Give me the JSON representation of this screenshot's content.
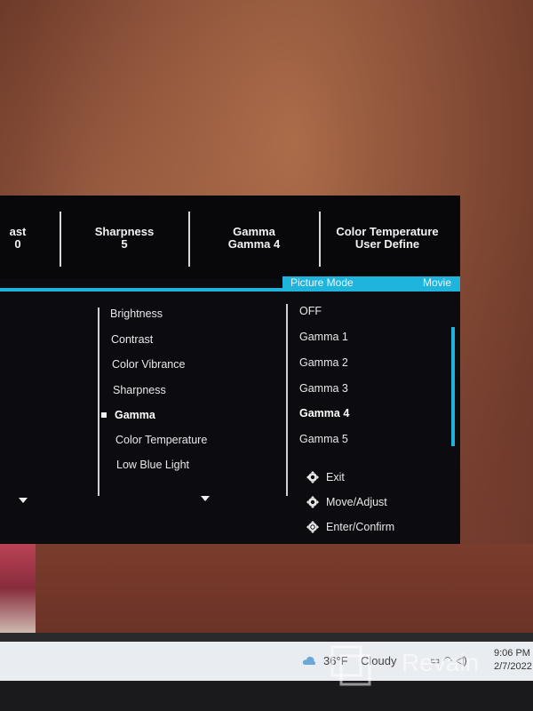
{
  "osd": {
    "top_bar": [
      {
        "label": "ast",
        "value": "0"
      },
      {
        "label": "Sharpness",
        "value": "5"
      },
      {
        "label": "Gamma",
        "value": "Gamma 4"
      },
      {
        "label": "Color Temperature",
        "value": "User Define"
      }
    ],
    "mode_tag": {
      "label": "Picture Mode",
      "value": "Movie"
    },
    "menu_items": [
      {
        "label": "Brightness",
        "active": false
      },
      {
        "label": "Contrast",
        "active": false
      },
      {
        "label": "Color Vibrance",
        "active": false
      },
      {
        "label": "Sharpness",
        "active": false
      },
      {
        "label": "Gamma",
        "active": true
      },
      {
        "label": "Color Temperature",
        "active": false
      },
      {
        "label": "Low Blue Light",
        "active": false
      }
    ],
    "options": [
      {
        "label": "OFF",
        "active": false
      },
      {
        "label": "Gamma 1",
        "active": false
      },
      {
        "label": "Gamma 2",
        "active": false
      },
      {
        "label": "Gamma 3",
        "active": false
      },
      {
        "label": "Gamma 4",
        "active": true
      },
      {
        "label": "Gamma 5",
        "active": false
      }
    ],
    "controls": [
      {
        "icon": "joystick-left-icon",
        "label": "Exit"
      },
      {
        "icon": "joystick-move-icon",
        "label": "Move/Adjust"
      },
      {
        "icon": "joystick-press-icon",
        "label": "Enter/Confirm"
      }
    ],
    "accent_color": "#1fb4dc"
  },
  "taskbar": {
    "weather_temp": "36°F",
    "weather_condition": "Cloudy",
    "time": "9:06 PM",
    "date": "2/7/2022"
  },
  "watermark": {
    "text": "Revain"
  }
}
